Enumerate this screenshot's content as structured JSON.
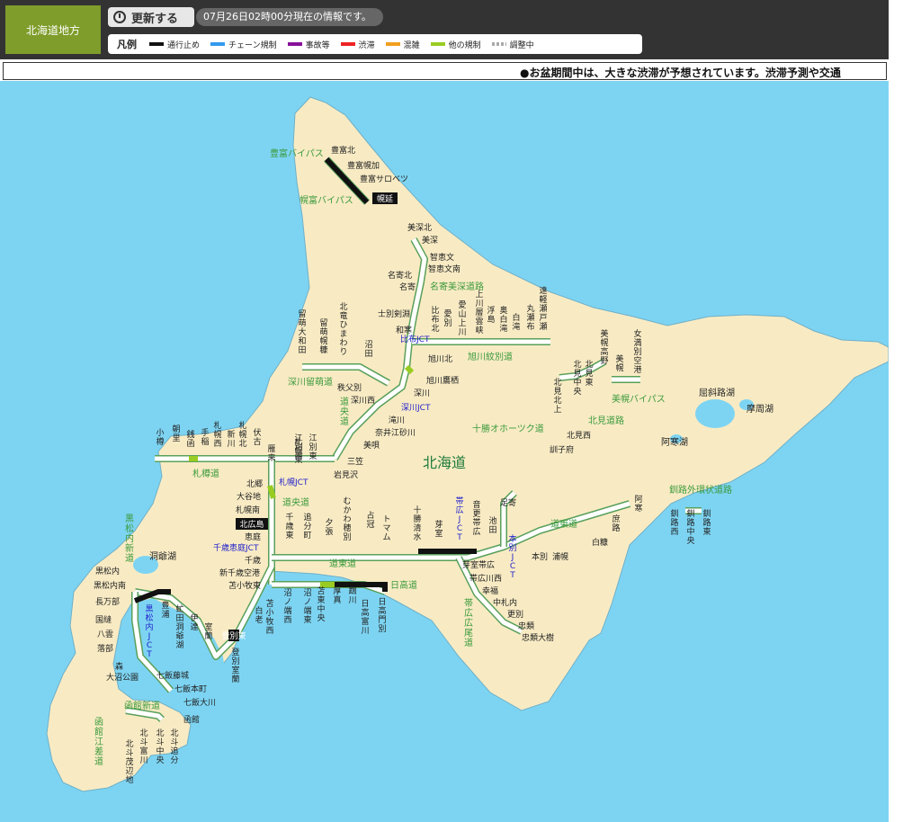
{
  "header": {
    "region": "北海道地方",
    "refresh_label": "更新する",
    "timestamp": "07月26日02時00分現在の情報です。",
    "legend_title": "凡例",
    "legend": [
      {
        "label": "通行止め",
        "color": "#111111",
        "style": "solid"
      },
      {
        "label": "チェーン規制",
        "color": "#3399ee",
        "style": "solid"
      },
      {
        "label": "事故等",
        "color": "#881199",
        "style": "solid"
      },
      {
        "label": "渋滞",
        "color": "#ee2222",
        "style": "solid"
      },
      {
        "label": "混雑",
        "color": "#f0a020",
        "style": "solid"
      },
      {
        "label": "他の規制",
        "color": "#99cc22",
        "style": "solid"
      },
      {
        "label": "調整中",
        "color": "#aaaaaa",
        "style": "dotted"
      }
    ]
  },
  "notice": "●お盆期間中は、大きな渋滞が予想されています。渋滞予測や交通",
  "map": {
    "colors": {
      "sea": "#7dd4f2",
      "land": "#f8ebc4",
      "road": "#ffffff",
      "road_edge": "#5aa05a",
      "road_name": "#3c9a3c",
      "jct": "#2222cc",
      "closed": "#111111",
      "other": "#99cc22"
    },
    "title": "北海道",
    "road_names": [
      {
        "id": "toyotomi-bypass",
        "text": "豊富バイパス"
      },
      {
        "id": "horonobe-bypass",
        "text": "幌富バイパス"
      },
      {
        "id": "nayoro-bifuka",
        "text": "名寄美深道路"
      },
      {
        "id": "asahikawa-mombetsu",
        "text": "旭川紋別道"
      },
      {
        "id": "fukagawa-rumoi",
        "text": "深川留萌道"
      },
      {
        "id": "doo",
        "text": "道央道"
      },
      {
        "id": "tokachi-okhotsk",
        "text": "十勝オホーツク道"
      },
      {
        "id": "bihoro-bypass",
        "text": "美幌バイパス"
      },
      {
        "id": "kitami",
        "text": "北見道路"
      },
      {
        "id": "sasson",
        "text": "札樽道"
      },
      {
        "id": "kushiro-outer",
        "text": "釧路外環状道路"
      },
      {
        "id": "doo-2",
        "text": "道央道"
      },
      {
        "id": "doto",
        "text": "道東道"
      },
      {
        "id": "doto-2",
        "text": "道東道"
      },
      {
        "id": "hidaka",
        "text": "日高道"
      },
      {
        "id": "obihiro-hiroo",
        "text": "帯広広尾道"
      },
      {
        "id": "kuromatsunai",
        "text": "黒松内新道"
      },
      {
        "id": "hakodate-shindo",
        "text": "函館新道"
      },
      {
        "id": "hakodate-esashi",
        "text": "函館江差道"
      }
    ],
    "jcts": [
      {
        "id": "pippu",
        "text": "比布JCT"
      },
      {
        "id": "fukagawa",
        "text": "深川JCT"
      },
      {
        "id": "sapporo",
        "text": "札幌JCT"
      },
      {
        "id": "chitose-eniwa",
        "text": "千歳恵庭JCT"
      },
      {
        "id": "obihiro",
        "text": "帯広JCT"
      },
      {
        "id": "honbetsu",
        "text": "本別JCT"
      },
      {
        "id": "kuromatsunai",
        "text": "黒松内JCT"
      }
    ],
    "place_names": [
      {
        "id": "kussharo",
        "text": "屈斜路湖"
      },
      {
        "id": "mashu",
        "text": "摩周湖"
      },
      {
        "id": "akan",
        "text": "阿寒湖"
      },
      {
        "id": "toya",
        "text": "洞爺湖"
      }
    ],
    "badges": [
      {
        "id": "horonobe",
        "text": "幌延"
      },
      {
        "id": "kita-hiroshima",
        "text": "北広島"
      },
      {
        "id": "noboribetsu-higashi",
        "text": "登別東"
      }
    ],
    "labels_h": [
      {
        "id": "toyotomi-kita",
        "text": "豊富北"
      },
      {
        "id": "toyotomi-horo",
        "text": "豊富幌加"
      },
      {
        "id": "toyotomi-sarobetsu",
        "text": "豊富サロベツ"
      },
      {
        "id": "bifuka-kita",
        "text": "美深北"
      },
      {
        "id": "bifuka",
        "text": "美深"
      },
      {
        "id": "chiebun",
        "text": "智恵文"
      },
      {
        "id": "chiebun-minami",
        "text": "智恵文南"
      },
      {
        "id": "nayoro-kita",
        "text": "名寄北"
      },
      {
        "id": "nayoro",
        "text": "名寄"
      },
      {
        "id": "shibetsu-kembuchi",
        "text": "士別剣淵"
      },
      {
        "id": "wassamu",
        "text": "和寒"
      },
      {
        "id": "asahikawa-kita",
        "text": "旭川北"
      },
      {
        "id": "asahikawa-takasu",
        "text": "旭川鷹栖"
      },
      {
        "id": "chippubetsu",
        "text": "秩父別"
      },
      {
        "id": "fukagawa-nishi",
        "text": "深川西"
      },
      {
        "id": "fukagawa",
        "text": "深川"
      },
      {
        "id": "takikawa",
        "text": "滝川"
      },
      {
        "id": "naie-sunagawa",
        "text": "奈井江砂川"
      },
      {
        "id": "bibai",
        "text": "美唄"
      },
      {
        "id": "mikasa",
        "text": "三笠"
      },
      {
        "id": "iwamizawa",
        "text": "岩見沢"
      },
      {
        "id": "kitami-nishi",
        "text": "北見西"
      },
      {
        "id": "kunneppu",
        "text": "訓子府"
      },
      {
        "id": "kitago",
        "text": "北郷"
      },
      {
        "id": "oyachi",
        "text": "大谷地"
      },
      {
        "id": "sapporo-minami",
        "text": "札幌南"
      },
      {
        "id": "eniwa",
        "text": "恵庭"
      },
      {
        "id": "chitose",
        "text": "千歳"
      },
      {
        "id": "shin-chitose-airport",
        "text": "新千歳空港"
      },
      {
        "id": "tomakomai-higashi",
        "text": "苫小牧東"
      },
      {
        "id": "ashoro",
        "text": "足寄"
      },
      {
        "id": "honbetsu",
        "text": "本別"
      },
      {
        "id": "urahoro",
        "text": "浦幌"
      },
      {
        "id": "shiranuka",
        "text": "白糠"
      },
      {
        "id": "memuro-obihiro",
        "text": "芽室帯広"
      },
      {
        "id": "obihiro-kawanishi",
        "text": "帯広川西"
      },
      {
        "id": "kofuku",
        "text": "幸福"
      },
      {
        "id": "nakasatsunai",
        "text": "中札内"
      },
      {
        "id": "sarabetsu",
        "text": "更別"
      },
      {
        "id": "churui",
        "text": "忠類"
      },
      {
        "id": "churui-taiju",
        "text": "忠類大樹"
      },
      {
        "id": "kuromatsunai",
        "text": "黒松内"
      },
      {
        "id": "kuromatsunai-minami",
        "text": "黒松内南"
      },
      {
        "id": "oshamambe",
        "text": "長万部"
      },
      {
        "id": "kunnui",
        "text": "国縫"
      },
      {
        "id": "yakumo",
        "text": "八雲"
      },
      {
        "id": "otoshibe",
        "text": "落部"
      },
      {
        "id": "mori",
        "text": "森"
      },
      {
        "id": "onuma-koen",
        "text": "大沼公園"
      },
      {
        "id": "nanae-fujishiro",
        "text": "七飯藤城"
      },
      {
        "id": "nanae-hommachi",
        "text": "七飯本町"
      },
      {
        "id": "nanae-ono",
        "text": "七飯大川"
      },
      {
        "id": "hakodate",
        "text": "函館"
      }
    ],
    "labels_v": [
      {
        "id": "rumoi-ohwada",
        "text": "留萌大和田"
      },
      {
        "id": "rumoi-horonuka",
        "text": "留萌幌糠"
      },
      {
        "id": "hokuryu-himawari",
        "text": "北竜ひまわり"
      },
      {
        "id": "numata",
        "text": "沼田"
      },
      {
        "id": "pippu-kita",
        "text": "比布北"
      },
      {
        "id": "aibetsu",
        "text": "愛別"
      },
      {
        "id": "kamikawa-soun",
        "text": "上川層雲峡"
      },
      {
        "id": "aizan-kamikawa",
        "text": "愛山上川"
      },
      {
        "id": "ukishima",
        "text": "浮島"
      },
      {
        "id": "okushirataki",
        "text": "奥白滝"
      },
      {
        "id": "shirataki",
        "text": "白滝"
      },
      {
        "id": "maruseppu",
        "text": "丸瀬布"
      },
      {
        "id": "engaru-seto",
        "text": "遠軽瀬戸瀬"
      },
      {
        "id": "bihoro-takano",
        "text": "美幌高野"
      },
      {
        "id": "bihoro",
        "text": "美幌"
      },
      {
        "id": "memanbetsu-airport",
        "text": "女満別空港"
      },
      {
        "id": "kitami-higashi",
        "text": "北見東"
      },
      {
        "id": "kitami-naka",
        "text": "北見中央"
      },
      {
        "id": "kitami-nishi",
        "text": "北見西"
      },
      {
        "id": "kitami-kami",
        "text": "北見北上"
      },
      {
        "id": "otaru",
        "text": "小樽"
      },
      {
        "id": "asari",
        "text": "朝里"
      },
      {
        "id": "zenibako",
        "text": "銭函"
      },
      {
        "id": "teine",
        "text": "手稲"
      },
      {
        "id": "sapporo-nishi",
        "text": "札幌西"
      },
      {
        "id": "shinkawa",
        "text": "新川"
      },
      {
        "id": "sapporo-kita",
        "text": "札幌北"
      },
      {
        "id": "fushiko",
        "text": "伏古"
      },
      {
        "id": "kariki",
        "text": "雁来"
      },
      {
        "id": "sapporo-higashi",
        "text": "札幌東"
      },
      {
        "id": "ebetsu-nishi",
        "text": "江別西"
      },
      {
        "id": "ebetsu-higashi",
        "text": "江別東"
      },
      {
        "id": "chitose-higashi",
        "text": "千歳東"
      },
      {
        "id": "oiwake",
        "text": "追分町"
      },
      {
        "id": "yubari",
        "text": "夕張"
      },
      {
        "id": "mukawa-hobetsu",
        "text": "むかわ穂別"
      },
      {
        "id": "shimukappu",
        "text": "占冠"
      },
      {
        "id": "tomamu",
        "text": "トマム"
      },
      {
        "id": "tokachi-shimizu",
        "text": "十勝清水"
      },
      {
        "id": "memuro",
        "text": "芽室"
      },
      {
        "id": "otofuke-obihiro",
        "text": "音更帯広"
      },
      {
        "id": "ikeda",
        "text": "池田"
      },
      {
        "id": "akan",
        "text": "阿寒"
      },
      {
        "id": "shoro",
        "text": "庶路"
      },
      {
        "id": "kushiro-nishi",
        "text": "釧路西"
      },
      {
        "id": "kushiro-chuo",
        "text": "釧路中央"
      },
      {
        "id": "kushiro-higashi",
        "text": "釧路東"
      },
      {
        "id": "hayakita",
        "text": "苫小牧西"
      },
      {
        "id": "numanohata-nishi",
        "text": "沼ノ端西"
      },
      {
        "id": "numanohata-higashi",
        "text": "沼ノ端東"
      },
      {
        "id": "tomakomai-chuo",
        "text": "苫東中央"
      },
      {
        "id": "atsuma",
        "text": "厚真"
      },
      {
        "id": "mukawa",
        "text": "鵡川"
      },
      {
        "id": "hidaka-tomikawa",
        "text": "日高富川"
      },
      {
        "id": "hidaka-mombetsu",
        "text": "日高門別"
      },
      {
        "id": "shiraoi",
        "text": "白老"
      },
      {
        "id": "noboribetsu-muroran",
        "text": "登別室蘭"
      },
      {
        "id": "muroran",
        "text": "室蘭"
      },
      {
        "id": "date",
        "text": "伊達"
      },
      {
        "id": "toyaura",
        "text": "虻田洞爺湖"
      },
      {
        "id": "toyoura",
        "text": "豊浦"
      },
      {
        "id": "hokuto-chuo",
        "text": "北斗中央"
      },
      {
        "id": "hokuto-tomikawa",
        "text": "北斗富川"
      },
      {
        "id": "hokuto-moheji",
        "text": "北斗茂辺地"
      },
      {
        "id": "hokuto-oiwake",
        "text": "北斗追分"
      }
    ]
  }
}
